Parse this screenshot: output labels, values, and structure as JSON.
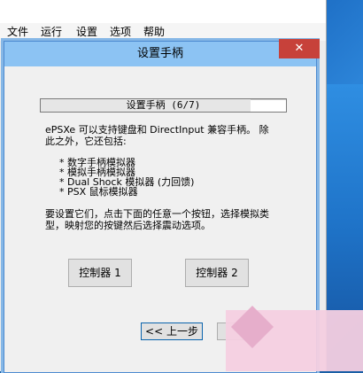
{
  "app": {
    "menu": [
      "文件",
      "运行",
      "设置",
      "选项",
      "帮助"
    ]
  },
  "dialog": {
    "title": "设置手柄",
    "close_label": "✕",
    "progress": {
      "label": "设置手柄 (6/7)",
      "value": 0.857
    },
    "intro_line1": "ePSXe 可以支持键盘和 DirectInput 兼容手柄。 除",
    "intro_line2": "此之外，它还包括:",
    "features": [
      "* 数字手柄模拟器",
      "* 模拟手柄模拟器",
      "* Dual Shock 模拟器 (力回馈)",
      "* PSX 鼠标模拟器"
    ],
    "instructions_line1": "要设置它们，点击下面的任意一个按钮，选择模拟类",
    "instructions_line2": "型，映射您的按键然后选择震动选项。",
    "controller1_label": "控制器 1",
    "controller2_label": "控制器 2",
    "back_label": "<< 上一步"
  }
}
